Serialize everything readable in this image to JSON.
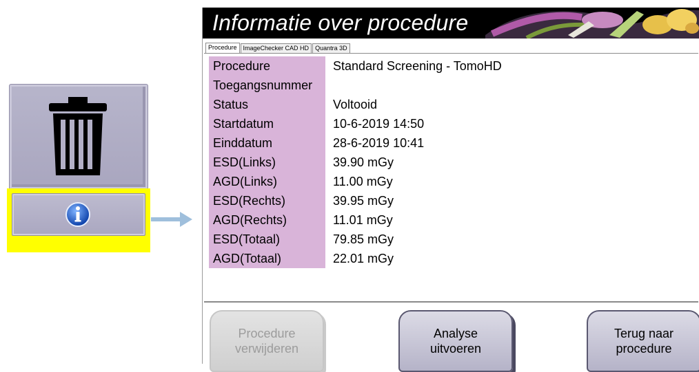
{
  "dialog": {
    "title": "Informatie over procedure",
    "tabs": [
      "Procedure",
      "ImageChecker CAD HD",
      "Quantra 3D"
    ],
    "rows": [
      {
        "label": "Procedure",
        "value": "Standard Screening - TomoHD"
      },
      {
        "label": "Toegangsnummer",
        "value": ""
      },
      {
        "label": "Status",
        "value": "Voltooid"
      },
      {
        "label": "Startdatum",
        "value": "10-6-2019 14:50"
      },
      {
        "label": "Einddatum",
        "value": "28-6-2019 10:41"
      },
      {
        "label": "ESD(Links)",
        "value": "39.90 mGy"
      },
      {
        "label": "AGD(Links)",
        "value": "11.00 mGy"
      },
      {
        "label": "ESD(Rechts)",
        "value": "39.95 mGy"
      },
      {
        "label": "AGD(Rechts)",
        "value": "11.01 mGy"
      },
      {
        "label": "ESD(Totaal)",
        "value": "79.85 mGy"
      },
      {
        "label": "AGD(Totaal)",
        "value": "22.01 mGy"
      }
    ],
    "buttons": {
      "delete": {
        "line1": "Procedure",
        "line2": "verwijderen"
      },
      "analyze": {
        "line1": "Analyse",
        "line2": "uitvoeren"
      },
      "back": {
        "line1": "Terug naar",
        "line2": "procedure"
      }
    }
  },
  "colors": {
    "label_bg": "#d9b4d9",
    "highlight": "#ffff00",
    "banner_bg": "#000000",
    "arrow": "#9fbfdc"
  },
  "icons": {
    "left_top": "trash-icon",
    "left_bottom": "info-icon",
    "connector": "arrow-right-icon"
  }
}
